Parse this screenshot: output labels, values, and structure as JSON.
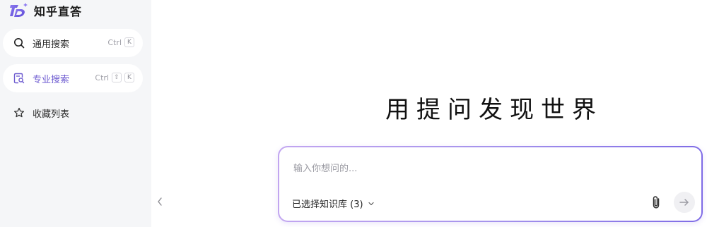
{
  "app": {
    "name": "知乎直答"
  },
  "sidebar": {
    "items": [
      {
        "label": "通用搜索",
        "icon": "search-icon",
        "shortcut_text": "Ctrl",
        "shortcut_keys": [
          "K"
        ]
      },
      {
        "label": "专业搜索",
        "icon": "document-search-icon",
        "shortcut_text": "Ctrl",
        "shortcut_keys": [
          "⇧",
          "K"
        ],
        "active_color": "#6d5bd0"
      },
      {
        "label": "收藏列表",
        "icon": "star-icon"
      }
    ]
  },
  "main": {
    "headline": "用提问发现世界",
    "input": {
      "placeholder": "输入你想问的...",
      "value": ""
    },
    "knowledge_base": {
      "label": "已选择知识库 (3)",
      "icon": "chevron-down-icon"
    },
    "attach_icon": "paperclip-icon",
    "send_icon": "arrow-right-icon",
    "collapse_icon": "chevron-left-icon"
  },
  "colors": {
    "brand": "#6d5bd0",
    "gradient_start": "#c2a6f0",
    "gradient_end": "#7f6ce6",
    "sidebar_bg": "#f5f6f8"
  }
}
